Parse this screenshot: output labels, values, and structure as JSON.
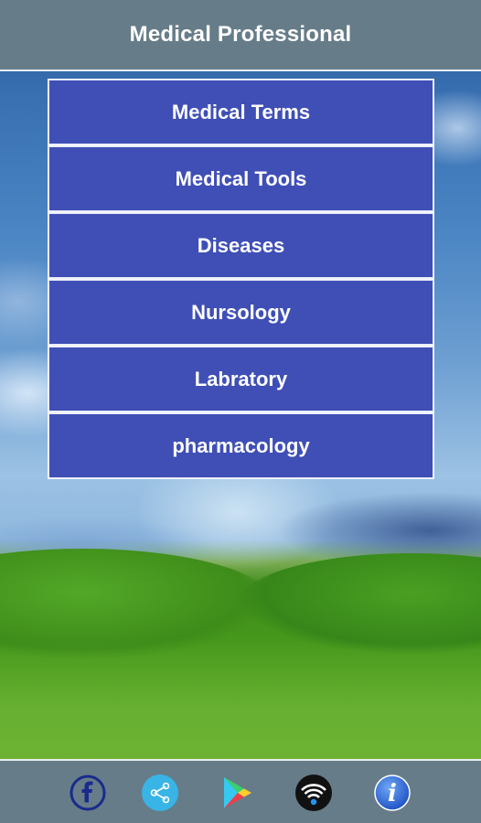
{
  "header": {
    "title": "Medical Professional"
  },
  "menu": {
    "items": [
      {
        "label": "Medical Terms"
      },
      {
        "label": "Medical Tools"
      },
      {
        "label": "Diseases"
      },
      {
        "label": "Nursology"
      },
      {
        "label": "Labratory"
      },
      {
        "label": "pharmacology"
      }
    ]
  },
  "bottom_bar": {
    "icons": [
      "facebook-icon",
      "share-icon",
      "play-store-icon",
      "wifi-icon",
      "info-icon"
    ]
  },
  "colors": {
    "header_bg": "#667c89",
    "menu_button_bg": "#3f4fb6",
    "text": "#ffffff",
    "bottom_bar_bg": "#667c89"
  }
}
